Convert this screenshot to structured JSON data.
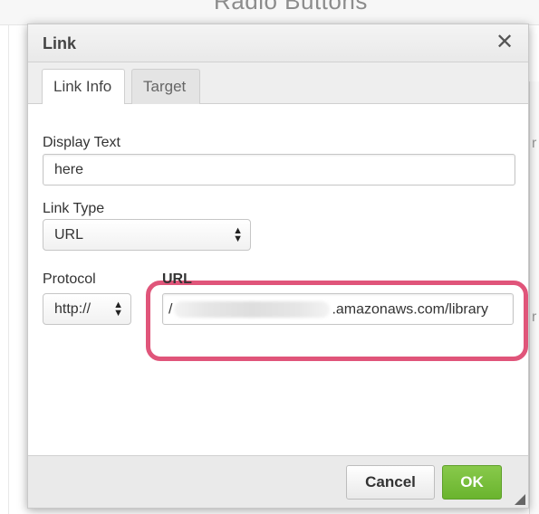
{
  "background": {
    "heading_text": "Radio Buttons",
    "right_fragments": [
      "r",
      "r"
    ]
  },
  "dialog": {
    "title": "Link",
    "close_glyph": "✕"
  },
  "tabs": [
    {
      "label": "Link Info",
      "active": true
    },
    {
      "label": "Target",
      "active": false
    }
  ],
  "form": {
    "display_text": {
      "label": "Display Text",
      "value": "here"
    },
    "link_type": {
      "label": "Link Type",
      "selected": "URL"
    },
    "protocol": {
      "label": "Protocol",
      "selected": "http://"
    },
    "url": {
      "label": "URL",
      "prefix": "/",
      "value_visible": ".amazonaws.com/library"
    }
  },
  "footer": {
    "cancel_label": "Cancel",
    "ok_label": "OK"
  },
  "colors": {
    "highlight": "#e0557a",
    "ok_button": "#6ab42e"
  },
  "icons": {
    "close": "close-icon",
    "select_arrows": "updown-arrows-icon",
    "resize": "resize-handle-icon"
  }
}
